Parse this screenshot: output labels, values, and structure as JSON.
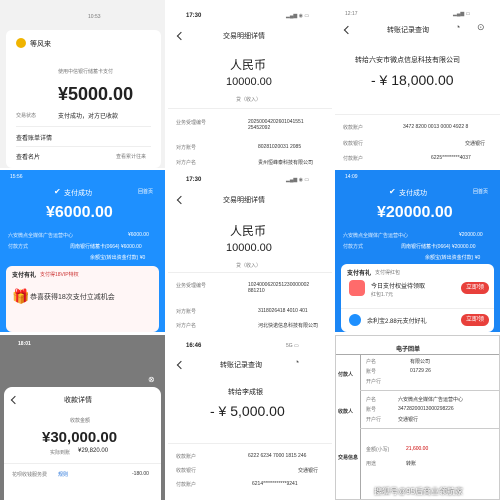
{
  "p1": {
    "status_time": "10:53",
    "user_name": "等风来",
    "method": "使用中信银行储蓄卡支付",
    "amount": "¥5000.00",
    "status_label": "交易状态",
    "status_value": "支付成功，对方已收款",
    "link_detail": "查看账单详情",
    "link_card": "查看名片",
    "link_history": "查看累计往来"
  },
  "p2": {
    "status_time": "17:30",
    "title": "交易明细详情",
    "currency": "人民币",
    "amount": "10000.00",
    "direction": "贷（收入）",
    "rows": [
      {
        "label": "业务受理编号",
        "value": "20250004202601041551 25452092"
      },
      {
        "label": "对方账号",
        "value": "80281020031 2085"
      },
      {
        "label": "对方户名",
        "value": "贵州恒峰泰科技有限公司"
      }
    ]
  },
  "p3": {
    "status_time": "12:17",
    "title": "转账记录查询",
    "payee": "转给六安市微点信息科技有限公司",
    "amount": "- ¥ 18,000.00",
    "rows": [
      {
        "label": "收款账户",
        "value": "3472 8200 0013 0000 4922 8"
      },
      {
        "label": "收款银行",
        "value": "交通银行"
      },
      {
        "label": "付款账户",
        "value": "6225*********4037"
      }
    ]
  },
  "p4": {
    "status_time": "15:56",
    "header_link": "回首页",
    "status": "支付成功",
    "amount": "¥6000.00",
    "rows": [
      {
        "label": "六安微点全媒体广告运营中心",
        "value": "¥6000.00"
      },
      {
        "label": "付款方式",
        "value": "周南银行储蓄卡(0664) ¥6000.00"
      },
      {
        "label": "",
        "value": "余额宝(转出资金付款) ¥0"
      }
    ],
    "promo_title": "支付有礼",
    "promo_tag": "支付得18VIP特权",
    "promo_text": "恭喜获得18次支付立减机会"
  },
  "p5": {
    "status_time": "17:30",
    "title": "交易明细详情",
    "currency": "人民币",
    "amount": "10000.00",
    "direction": "贷（收入）",
    "rows": [
      {
        "label": "业务受理编号",
        "value": "1024000620251230000002 881210"
      },
      {
        "label": "对方账号",
        "value": "3118026418 4010 401"
      },
      {
        "label": "对方户名",
        "value": "河北快诺信息科技有限公司"
      }
    ]
  },
  "p6": {
    "status_time": "14:09",
    "header_link": "回首页",
    "status": "支付成功",
    "amount": "¥20000.00",
    "rows": [
      {
        "label": "六安微点全媒体广告运营中心",
        "value": "¥20000.00"
      },
      {
        "label": "付款方式",
        "value": "周南银行储蓄卡(0664) ¥20000.00"
      },
      {
        "label": "",
        "value": "余额宝(转出资金付款) ¥0"
      }
    ],
    "promo_title": "支付有礼",
    "promo_sub": "支付得红包",
    "promo_item": "今日支付权益待领取",
    "promo_item_sub": "红包1.7元",
    "promo_btn": "立即领",
    "promo2": "余利宝2.88元支付好礼",
    "promo2_btn": "立即领"
  },
  "p7": {
    "status_time": "18:01",
    "title": "收款详情",
    "label_amount": "收款金额",
    "amount": "¥30,000.00",
    "settled_label": "实际到账",
    "settled": "¥29,820.00",
    "fee_label": "花呗收钱服务费",
    "fee_link": "规则",
    "fee": "-180.00"
  },
  "p8": {
    "status_time": "16:46",
    "title": "转账记录查询",
    "payee": "转给李成银",
    "amount": "- ¥ 5,000.00",
    "rows": [
      {
        "label": "收款账户",
        "value": "6222 6234 7000 1815 246"
      },
      {
        "label": "收款银行",
        "value": "交通银行"
      },
      {
        "label": "付款账户",
        "value": "6214************9241"
      }
    ]
  },
  "p9": {
    "header": "电子回单",
    "rows": [
      {
        "label": "户名",
        "value": "有限公司"
      },
      {
        "label": "账号",
        "value": "01729 26"
      },
      {
        "label": "开户行",
        "value": ""
      },
      {
        "label": "户名",
        "value": "六安微点全媒体广告运营中心"
      },
      {
        "label": "账号",
        "value": "34728200013000298226"
      },
      {
        "label": "开户行",
        "value": "交通银行"
      },
      {
        "label": "金额(小写)",
        "value": "21,600.00"
      },
      {
        "label": "用途",
        "value": "转账"
      }
    ],
    "side_labels": [
      "付款人",
      "收款人",
      "交易信息"
    ],
    "watermark": "搜狐号@95后商业领航家"
  }
}
